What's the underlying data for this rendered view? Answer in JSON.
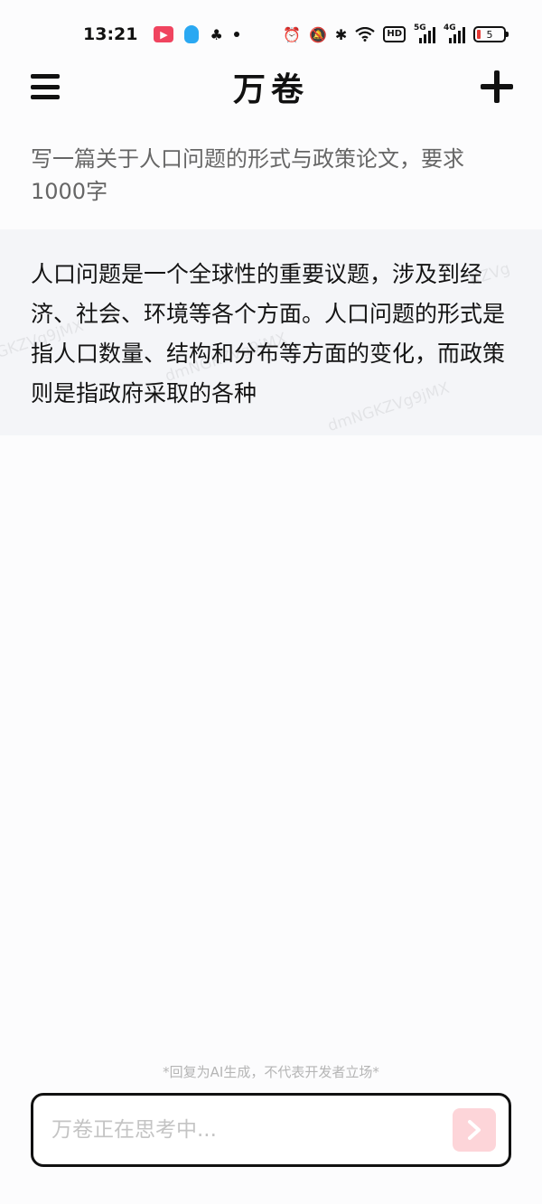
{
  "status_bar": {
    "time": "13:21",
    "network_badge": "HD",
    "signal_1_gen": "5G",
    "signal_2_gen": "4G",
    "battery_level": "5"
  },
  "header": {
    "title": "万卷"
  },
  "conversation": {
    "user_prompt": "写一篇关于人口问题的形式与政策论文，要求1000字",
    "assistant_response": "人口问题是一个全球性的重要议题，涉及到经济、社会、环境等各个方面。人口问题的形式是指人口数量、结构和分布等方面的变化，而政策则是指政府采取的各种"
  },
  "footer": {
    "disclaimer": "*回复为AI生成，不代表开发者立场*",
    "input_placeholder": "万卷正在思考中..."
  },
  "colors": {
    "accent_send": "#fdd5d9",
    "assistant_bg": "#f4f5f8"
  }
}
